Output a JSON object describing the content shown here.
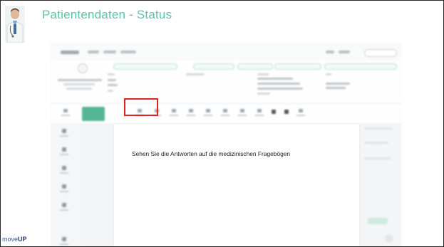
{
  "slide": {
    "title": "Patientendaten - Status",
    "footer_brand_light": "move",
    "footer_brand_bold": "UP"
  },
  "modal": {
    "text": "Sehen Sie die Antworten auf die medizinischen Fragebögen"
  },
  "colors": {
    "title": "#5cc4a8",
    "highlight": "#e0241f",
    "app_green": "#4cb38f"
  },
  "icons": [
    "doctor-avatar-icon",
    "app-logo-icon",
    "user-menu-icon"
  ]
}
